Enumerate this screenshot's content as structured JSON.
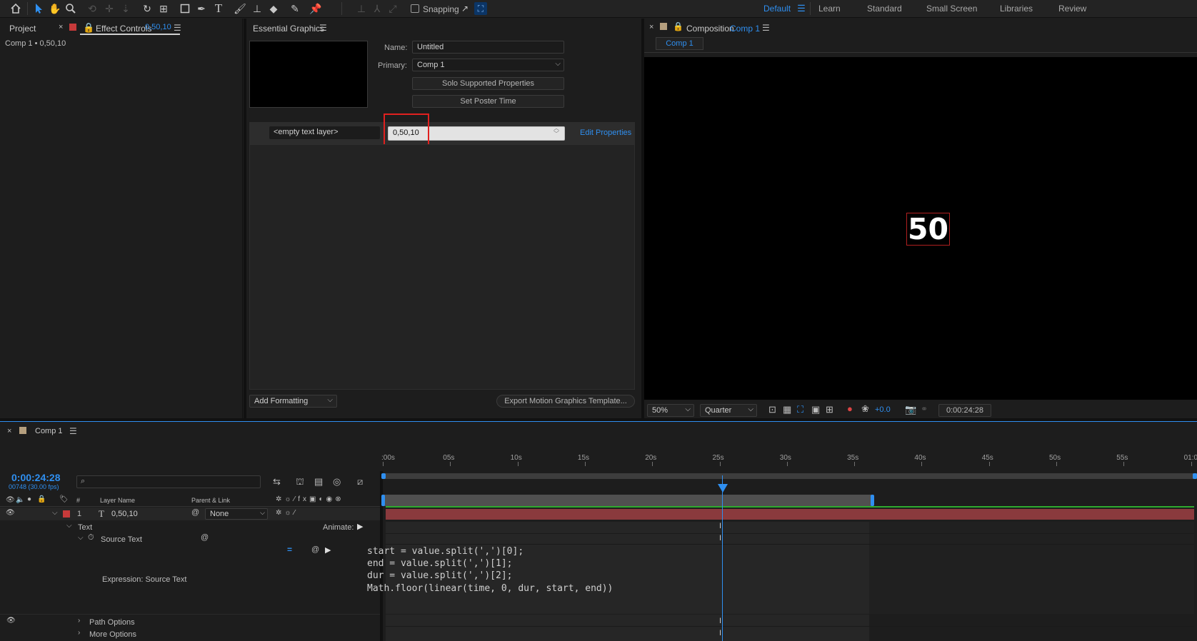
{
  "toolbar": {
    "snapping_label": "Snapping",
    "workspaces": [
      "Default",
      "Learn",
      "Standard",
      "Small Screen",
      "Libraries",
      "Review"
    ],
    "active_workspace": "Default"
  },
  "left_panel": {
    "tab_project": "Project",
    "tab_effect_controls": "Effect Controls",
    "effect_controls_target": "0,50,10",
    "breadcrumb": "Comp 1 • 0,50,10"
  },
  "essential_graphics": {
    "title": "Essential Graphics",
    "name_label": "Name:",
    "name_value": "Untitled",
    "primary_label": "Primary:",
    "primary_value": "Comp 1",
    "solo_button": "Solo Supported Properties",
    "poster_button": "Set Poster Time",
    "property_label": "<empty text layer>",
    "property_value": "0,50,10",
    "edit_properties": "Edit Properties",
    "add_formatting": "Add Formatting",
    "export_button": "Export Motion Graphics Template..."
  },
  "composition": {
    "tab_label": "Composition",
    "comp_name": "Comp 1",
    "sub_tab": "Comp 1",
    "canvas_text": "50",
    "zoom": "50%",
    "resolution": "Quarter",
    "exposure": "+0.0",
    "timecode": "0:00:24:28"
  },
  "timeline": {
    "comp_tab": "Comp 1",
    "current_time": "0:00:24:28",
    "frame_info": "00748 (30.00 fps)",
    "search_placeholder": "",
    "col_number": "#",
    "col_layer_name": "Layer Name",
    "col_parent": "Parent & Link",
    "layer_index": "1",
    "layer_name": "0,50,10",
    "parent_value": "None",
    "text_group": "Text",
    "animate_label": "Animate:",
    "source_text": "Source Text",
    "expression_label": "Expression: Source Text",
    "path_options": "Path Options",
    "more_options": "More Options",
    "ruler_labels": [
      ":00s",
      "05s",
      "10s",
      "15s",
      "20s",
      "25s",
      "30s",
      "35s",
      "40s",
      "45s",
      "50s",
      "55s",
      "01:0"
    ],
    "expression_lines": [
      "start = value.split(',')[0];",
      "end = value.split(',')[1];",
      "dur = value.split(',')[2];",
      "Math.floor(linear(time, 0, dur, start, end))"
    ]
  },
  "colors": {
    "accent": "#2f8ff0",
    "layer_bar": "#8a3a3d",
    "label_red": "#c63a3a",
    "highlight_box": "#e0201f",
    "work_area_green": "#2faa2f"
  }
}
